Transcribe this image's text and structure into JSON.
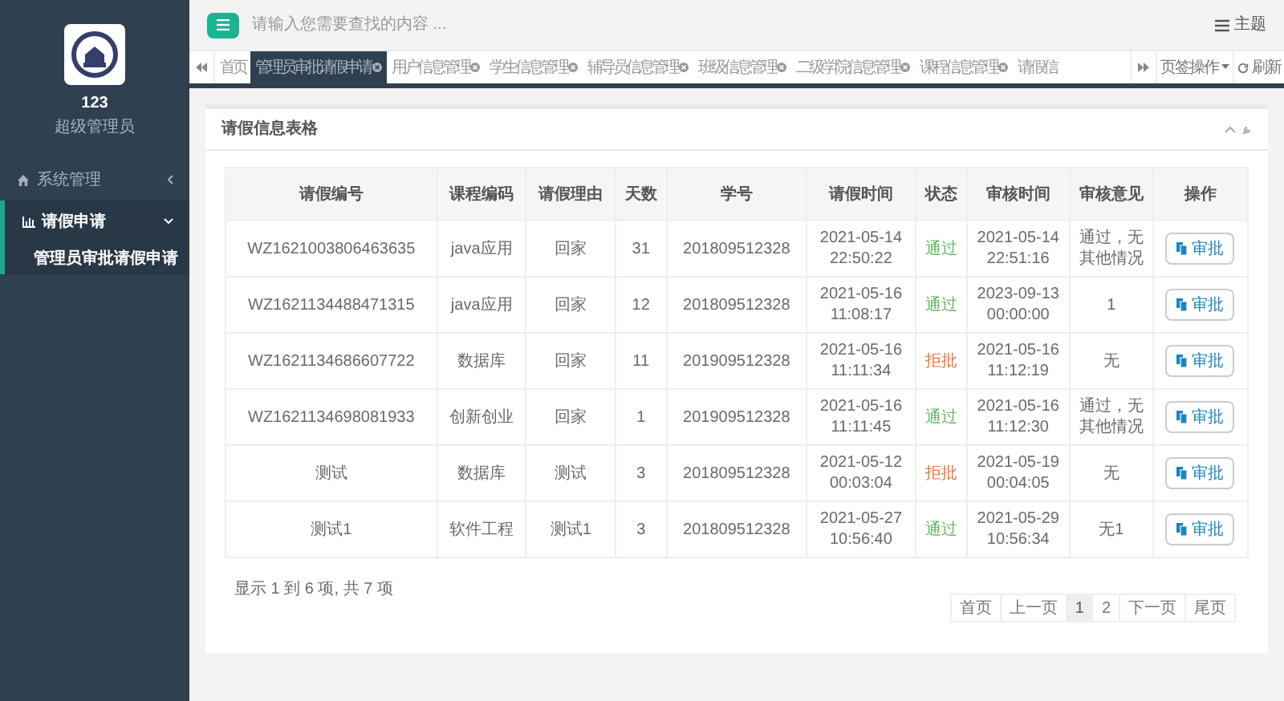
{
  "sidebar": {
    "user": {
      "name": "123",
      "role": "超级管理员"
    },
    "items": [
      {
        "label": "系统管理",
        "expanded": false,
        "selected": false
      },
      {
        "label": "请假申请",
        "expanded": true,
        "selected": true,
        "children": [
          {
            "label": "管理员审批请假申请",
            "selected": true
          }
        ]
      }
    ]
  },
  "topbar": {
    "search": {
      "placeholder": "请输入您需要查找的内容 ..."
    },
    "theme": "主题"
  },
  "tabs": [
    {
      "label": "首页",
      "selected": false,
      "closable": false
    },
    {
      "label": "管理员审批请假申请",
      "selected": true,
      "closable": true
    },
    {
      "label": "用户信息管理",
      "selected": false,
      "closable": true
    },
    {
      "label": "学生信息管理",
      "selected": false,
      "closable": true
    },
    {
      "label": "辅导员信息管理",
      "selected": false,
      "closable": true
    },
    {
      "label": "班级信息管理",
      "selected": false,
      "closable": true
    },
    {
      "label": "二级学院信息管理",
      "selected": false,
      "closable": true
    },
    {
      "label": "课程信息管理",
      "selected": false,
      "closable": true
    },
    {
      "label": "请假信",
      "selected": false,
      "closable": false
    }
  ],
  "tab_actions": {
    "menu": "页签操作",
    "refresh": "刷新"
  },
  "card": {
    "title": "请假信息表格",
    "table": {
      "columns": [
        "请假编号",
        "课程编码",
        "请假理由",
        "天数",
        "学号",
        "请假时间",
        "状态",
        "审核时间",
        "审核意见",
        "操作"
      ],
      "rows": [
        {
          "cells": [
            "WZ1621003806463635",
            "java应用",
            "回家",
            "31",
            "201809512328",
            "2021-05-14 22:50:22"
          ],
          "status": {
            "text": "通过",
            "color": "#5cb85c"
          },
          "review_time": "2021-05-14 22:51:16",
          "opinion": "通过，无其他情况",
          "action": "审批"
        },
        {
          "cells": [
            "WZ1621134488471315",
            "java应用",
            "回家",
            "12",
            "201809512328",
            "2021-05-16 11:08:17"
          ],
          "status": {
            "text": "通过",
            "color": "#5cb85c"
          },
          "review_time": "2023-09-13 00:00:00",
          "opinion": "1",
          "action": "审批"
        },
        {
          "cells": [
            "WZ1621134686607722",
            "数据库",
            "回家",
            "11",
            "201909512328",
            "2021-05-16 11:11:34"
          ],
          "status": {
            "text": "拒批",
            "color": "#e8743b"
          },
          "review_time": "2021-05-16 11:12:19",
          "opinion": "无",
          "action": "审批"
        },
        {
          "cells": [
            "WZ1621134698081933",
            "创新创业",
            "回家",
            "1",
            "201909512328",
            "2021-05-16 11:11:45"
          ],
          "status": {
            "text": "通过",
            "color": "#5cb85c"
          },
          "review_time": "2021-05-16 11:12:30",
          "opinion": "通过，无其他情况",
          "action": "审批"
        },
        {
          "cells": [
            "测试",
            "数据库",
            "测试",
            "3",
            "201809512328",
            "2021-05-12 00:03:04"
          ],
          "status": {
            "text": "拒批",
            "color": "#e8743b"
          },
          "review_time": "2021-05-19 00:04:05",
          "opinion": "无",
          "action": "审批"
        },
        {
          "cells": [
            "测试1",
            "软件工程",
            "测试1",
            "3",
            "201809512328",
            "2021-05-27 10:56:40"
          ],
          "status": {
            "text": "通过",
            "color": "#5cb85c"
          },
          "review_time": "2021-05-29 10:56:34",
          "opinion": "无1",
          "action": "审批"
        }
      ]
    },
    "summary": "显示 1 到 6 项, 共 7 项",
    "pagination": [
      {
        "label": "首页",
        "selected": false
      },
      {
        "label": "上一页",
        "selected": false
      },
      {
        "label": "1",
        "selected": true
      },
      {
        "label": "2",
        "selected": false
      },
      {
        "label": "下一页",
        "selected": false
      },
      {
        "label": "尾页",
        "selected": false
      }
    ]
  }
}
